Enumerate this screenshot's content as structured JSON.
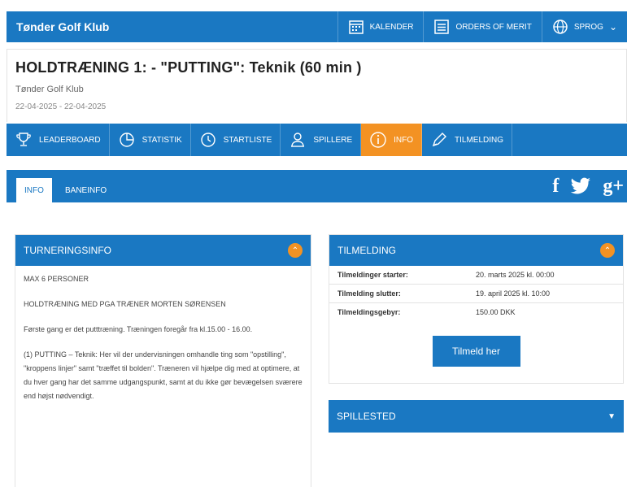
{
  "topbar": {
    "brand": "Tønder Golf Klub",
    "nav": [
      {
        "label": "KALENDER",
        "icon": "calendar-icon"
      },
      {
        "label": "ORDERS OF MERIT",
        "icon": "list-icon"
      },
      {
        "label": "SPROG",
        "icon": "globe-icon"
      }
    ]
  },
  "event": {
    "title": "HOLDTRÆNING 1: - \"PUTTING\": Teknik (60 min )",
    "club": "Tønder Golf Klub",
    "dates": "22-04-2025 - 22-04-2025"
  },
  "tabs": [
    {
      "label": "LEADERBOARD",
      "icon": "trophy-icon"
    },
    {
      "label": "STATISTIK",
      "icon": "pie-chart-icon"
    },
    {
      "label": "STARTLISTE",
      "icon": "clock-icon"
    },
    {
      "label": "SPILLERE",
      "icon": "players-icon"
    },
    {
      "label": "INFO",
      "icon": "info-icon",
      "active": true
    },
    {
      "label": "TILMELDING",
      "icon": "pencil-icon"
    }
  ],
  "subtabs": {
    "info": "INFO",
    "baneinfo": "BANEINFO"
  },
  "social": {
    "facebook": "f",
    "googleplus": "g+"
  },
  "turneringsinfo": {
    "title": "TURNERINGSINFO",
    "paragraphs": [
      "MAX 6 PERSONER",
      "HOLDTRÆNING MED PGA TRÆNER MORTEN SØRENSEN",
      "Første gang er det putttræning. Træningen foregår fra kl.15.00 - 16.00.",
      "(1) PUTTING – Teknik: Her vil der undervisningen omhandle ting som \"opstilling\", \"kroppens linjer\" samt \"træffet til bolden\". Træneren vil hjælpe dig med at optimere, at du hver gang har det samme udgangspunkt, samt at du ikke gør bevægelsen sværere end højst nødvendigt."
    ]
  },
  "tilmelding": {
    "title": "TILMELDING",
    "rows": [
      {
        "key": "Tilmeldinger starter:",
        "value": "20. marts 2025 kl. 00:00"
      },
      {
        "key": "Tilmelding slutter:",
        "value": "19. april 2025 kl. 10:00"
      },
      {
        "key": "Tilmeldingsgebyr:",
        "value": "150.00 DKK"
      }
    ],
    "button": "Tilmeld her"
  },
  "spillested": {
    "title": "SPILLESTED"
  },
  "colors": {
    "primary": "#1a78c2",
    "accent": "#f39223"
  }
}
